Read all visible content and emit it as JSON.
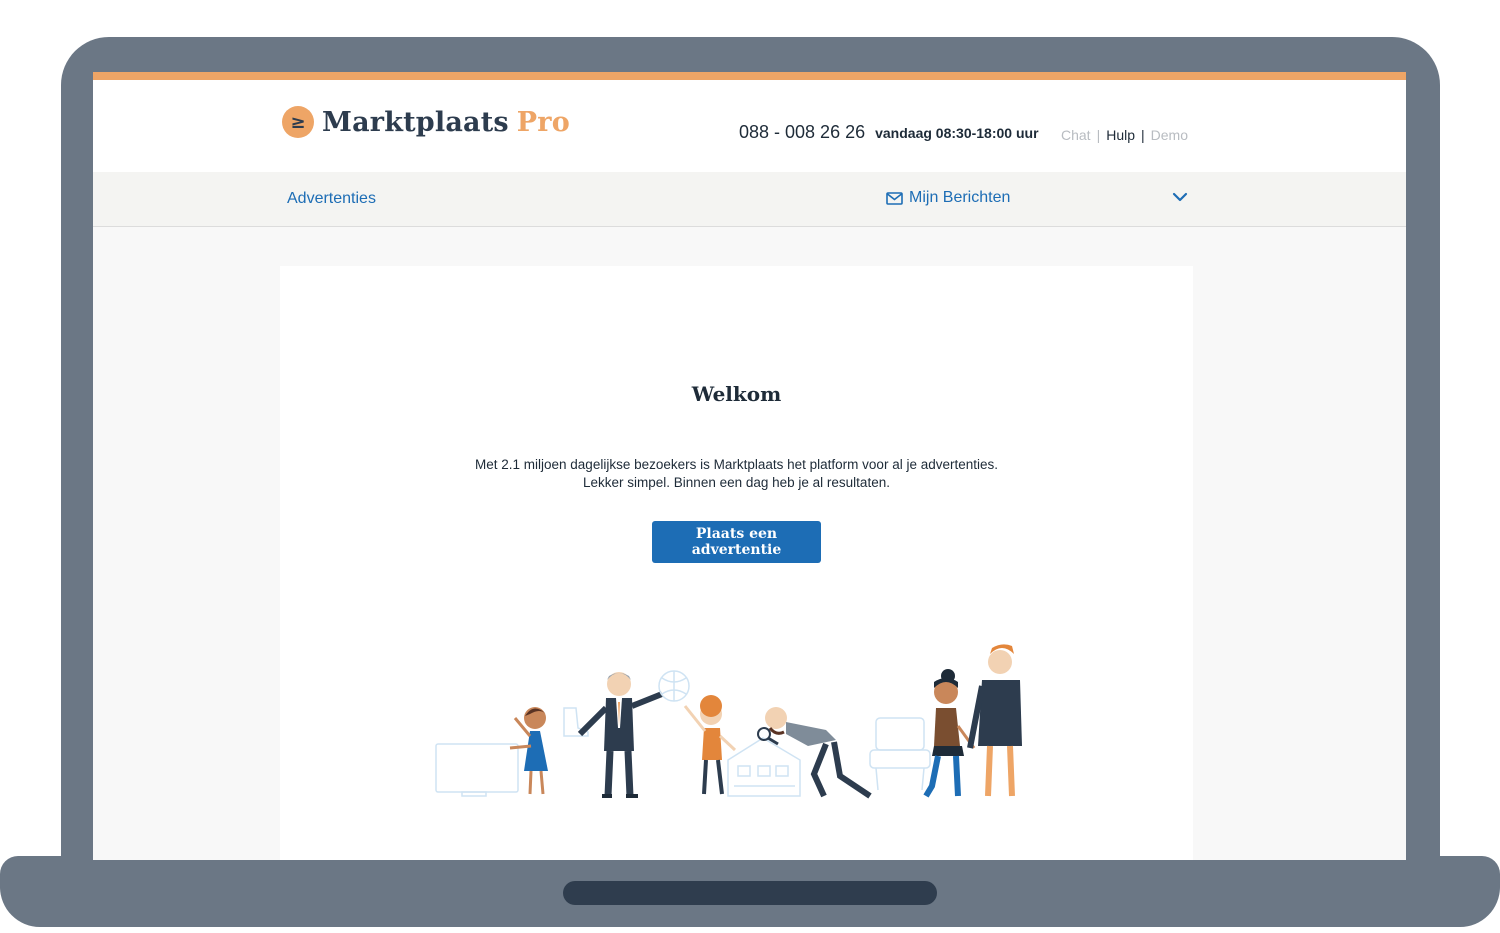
{
  "header": {
    "logo_name": "Marktplaats",
    "logo_suffix": "Pro",
    "logo_mark_glyph": "≥",
    "phone": "088 - 008 26 26",
    "hours": "vandaag 08:30-18:00 uur",
    "links": {
      "chat": "Chat",
      "help": "Hulp",
      "demo": "Demo"
    },
    "separator": "|"
  },
  "nav": {
    "ads": "Advertenties",
    "messages": "Mijn Berichten",
    "messages_icon": "envelope-icon",
    "dropdown_icon": "chevron-down-icon"
  },
  "main": {
    "title": "Welkom",
    "intro_line1": "Met 2.1 miljoen dagelijkse bezoekers is Marktplaats het platform voor al je advertenties.",
    "intro_line2": "Lekker simpel. Binnen een dag heb je al resultaten.",
    "cta": "Plaats een advertentie"
  },
  "colors": {
    "accent": "#eea566",
    "primary": "#1d6db5",
    "text": "#1e2b38",
    "frame": "#6b7785"
  }
}
